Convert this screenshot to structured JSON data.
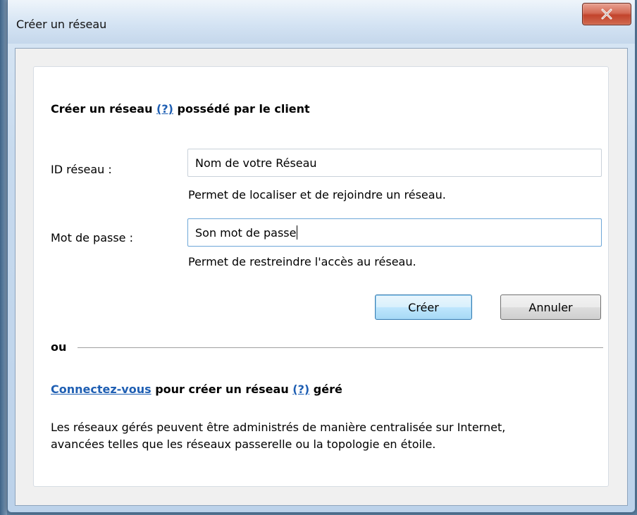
{
  "window": {
    "title": "Créer un réseau"
  },
  "owned_section": {
    "heading_before": "Créer un réseau",
    "help_link": "(?)",
    "heading_after": "possédé par le client"
  },
  "network_id": {
    "label": "ID réseau :",
    "value": "Nom de votre Réseau",
    "hint": "Permet de localiser et de rejoindre un réseau."
  },
  "password": {
    "label": "Mot de passe :",
    "value": "Son mot de passe",
    "hint": "Permet de restreindre l'accès au réseau."
  },
  "buttons": {
    "create": "Créer",
    "cancel": "Annuler"
  },
  "separator": {
    "label": "ou"
  },
  "managed_section": {
    "login_link": "Connectez-vous",
    "heading_middle": "pour créer un réseau",
    "help_link": "(?)",
    "heading_after": "géré",
    "description_line1": "Les réseaux gérés peuvent être administrés de manière centralisée sur Internet,",
    "description_line2": "avancées telles que les réseaux passerelle ou la topologie en étoile."
  },
  "icons": {
    "close": "close-icon"
  }
}
